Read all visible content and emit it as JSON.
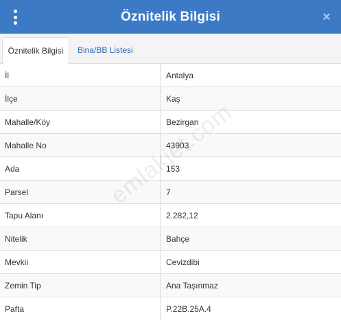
{
  "header": {
    "title": "Öznitelik Bilgisi",
    "menu_icon": "vertical-dots-icon",
    "close_icon": "close-icon",
    "close_glyph": "×",
    "color": "#3d7ac6"
  },
  "tabs": [
    {
      "label": "Öznitelik Bilgisi",
      "active": true
    },
    {
      "label": "Bina/BB Listesi",
      "active": false
    }
  ],
  "rows": [
    {
      "label": "İl",
      "value": "Antalya"
    },
    {
      "label": "İlçe",
      "value": "Kaş"
    },
    {
      "label": "Mahalle/Köy",
      "value": "Bezirgan"
    },
    {
      "label": "Mahalle No",
      "value": "43903"
    },
    {
      "label": "Ada",
      "value": "153"
    },
    {
      "label": "Parsel",
      "value": "7"
    },
    {
      "label": "Tapu Alanı",
      "value": "2.282,12"
    },
    {
      "label": "Nitelik",
      "value": "Bahçe"
    },
    {
      "label": "Mevkii",
      "value": "Cevizdibi"
    },
    {
      "label": "Zemin Tip",
      "value": "Ana Taşınmaz"
    },
    {
      "label": "Pafta",
      "value": "P.22B.25A.4"
    }
  ],
  "watermark": "emlakjet.com"
}
